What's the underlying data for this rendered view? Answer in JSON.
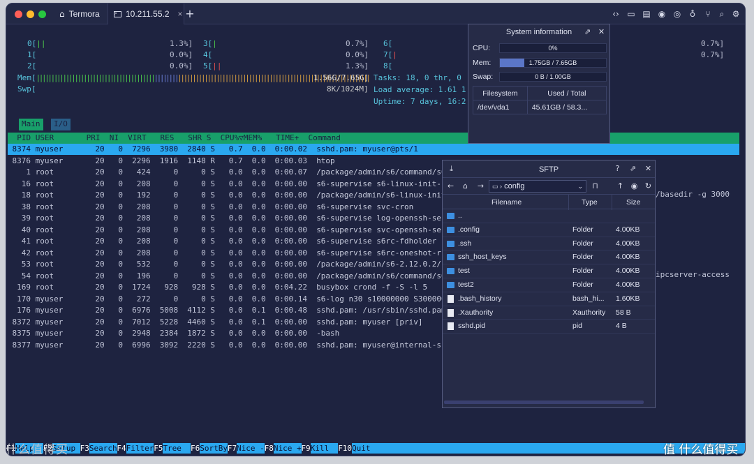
{
  "tabs": [
    {
      "label": "Termora"
    },
    {
      "label": "10.211.55.2"
    }
  ],
  "toolbar_icons": [
    "code-icon",
    "folder-icon",
    "document-icon",
    "record-icon",
    "pin-icon",
    "branch-icon",
    "search-icon",
    "gear-icon"
  ],
  "htop": {
    "cpus": [
      {
        "id": "0[",
        "meter": "||",
        "pct": "1.3%]"
      },
      {
        "id": "1[",
        "meter": "",
        "pct": "0.0%]"
      },
      {
        "id": "2[",
        "meter": "",
        "pct": "0.0%]"
      },
      {
        "id": "3[",
        "meter": "|",
        "pct": "0.7%]"
      },
      {
        "id": "4[",
        "meter": "",
        "pct": "0.0%]"
      },
      {
        "id": "5[",
        "meter": "||",
        "pct": "1.3%]"
      },
      {
        "id": "6[",
        "meter": "",
        "pct": "0.7%]"
      },
      {
        "id": "7[",
        "meter": "|",
        "pct": "0.7%]"
      },
      {
        "id": "8[",
        "meter": "",
        "pct": ""
      }
    ],
    "mem_label": "Mem[",
    "mem_meter": "||||||||||||||||||||||||||||||||||||||||||||||||||||||||||||||",
    "mem_value": "1.56G/7.65G]",
    "swp_label": "Swp[",
    "swp_value": "8K/1024M]",
    "tasks": "Tasks: 18, 0 thr, 0",
    "load": "Load average: 1.61 1",
    "uptime": "Uptime: 7 days, 16:2",
    "tab_main": "Main",
    "tab_io": "I/O",
    "columns": "  PID USER       PRI  NI  VIRT   RES   SHR S  CPU%▽MEM%   TIME+  Command",
    "processes": [
      {
        "pid": "8374",
        "user": "myuser",
        "pri": "20",
        "ni": "0",
        "virt": "7296",
        "res": "3980",
        "shr": "2840",
        "s": "S",
        "cpu": "0.7",
        "mem": "0.0",
        "time": "0:00.02",
        "cmd": "sshd.pam: myuser@pts/1"
      },
      {
        "pid": "8376",
        "user": "myuser",
        "pri": "20",
        "ni": "0",
        "virt": "2296",
        "res": "1916",
        "shr": "1148",
        "s": "R",
        "cpu": "0.7",
        "mem": "0.0",
        "time": "0:00.03",
        "cmd": "htop"
      },
      {
        "pid": "1",
        "user": "root",
        "pri": "20",
        "ni": "0",
        "virt": "424",
        "res": "0",
        "shr": "0",
        "s": "S",
        "cpu": "0.0",
        "mem": "0.0",
        "time": "0:00.07",
        "cmd": "/package/admin/s6/command/s6-"
      },
      {
        "pid": "16",
        "user": "root",
        "pri": "20",
        "ni": "0",
        "virt": "208",
        "res": "0",
        "shr": "0",
        "s": "S",
        "cpu": "0.0",
        "mem": "0.0",
        "time": "0:00.00",
        "cmd": "s6-supervise s6-linux-init-sh"
      },
      {
        "pid": "18",
        "user": "root",
        "pri": "20",
        "ni": "0",
        "virt": "192",
        "res": "0",
        "shr": "0",
        "s": "S",
        "cpu": "0.0",
        "mem": "0.0",
        "time": "0:00.00",
        "cmd": "/package/admin/s6-linux-init/"
      },
      {
        "pid": "38",
        "user": "root",
        "pri": "20",
        "ni": "0",
        "virt": "208",
        "res": "0",
        "shr": "0",
        "s": "S",
        "cpu": "0.0",
        "mem": "0.0",
        "time": "0:00.00",
        "cmd": "s6-supervise svc-cron"
      },
      {
        "pid": "39",
        "user": "root",
        "pri": "20",
        "ni": "0",
        "virt": "208",
        "res": "0",
        "shr": "0",
        "s": "S",
        "cpu": "0.0",
        "mem": "0.0",
        "time": "0:00.00",
        "cmd": "s6-supervise log-openssh-serv"
      },
      {
        "pid": "40",
        "user": "root",
        "pri": "20",
        "ni": "0",
        "virt": "208",
        "res": "0",
        "shr": "0",
        "s": "S",
        "cpu": "0.0",
        "mem": "0.0",
        "time": "0:00.00",
        "cmd": "s6-supervise svc-openssh-serv"
      },
      {
        "pid": "41",
        "user": "root",
        "pri": "20",
        "ni": "0",
        "virt": "208",
        "res": "0",
        "shr": "0",
        "s": "S",
        "cpu": "0.0",
        "mem": "0.0",
        "time": "0:00.00",
        "cmd": "s6-supervise s6rc-fdholder"
      },
      {
        "pid": "42",
        "user": "root",
        "pri": "20",
        "ni": "0",
        "virt": "208",
        "res": "0",
        "shr": "0",
        "s": "S",
        "cpu": "0.0",
        "mem": "0.0",
        "time": "0:00.00",
        "cmd": "s6-supervise s6rc-oneshot-run"
      },
      {
        "pid": "53",
        "user": "root",
        "pri": "20",
        "ni": "0",
        "virt": "532",
        "res": "0",
        "shr": "0",
        "s": "S",
        "cpu": "0.0",
        "mem": "0.0",
        "time": "0:00.00",
        "cmd": "/package/admin/s6-2.12.0.2/co"
      },
      {
        "pid": "54",
        "user": "root",
        "pri": "20",
        "ni": "0",
        "virt": "196",
        "res": "0",
        "shr": "0",
        "s": "S",
        "cpu": "0.0",
        "mem": "0.0",
        "time": "0:00.00",
        "cmd": "/package/admin/s6/command/s6-"
      },
      {
        "pid": "169",
        "user": "root",
        "pri": "20",
        "ni": "0",
        "virt": "1724",
        "res": "928",
        "shr": "928",
        "s": "S",
        "cpu": "0.0",
        "mem": "0.0",
        "time": "0:04.22",
        "cmd": "busybox crond -f -S -l 5"
      },
      {
        "pid": "170",
        "user": "myuser",
        "pri": "20",
        "ni": "0",
        "virt": "272",
        "res": "0",
        "shr": "0",
        "s": "S",
        "cpu": "0.0",
        "mem": "0.0",
        "time": "0:00.14",
        "cmd": "s6-log n30 s10000000 S3000000"
      },
      {
        "pid": "176",
        "user": "myuser",
        "pri": "20",
        "ni": "0",
        "virt": "6976",
        "res": "5008",
        "shr": "4112",
        "s": "S",
        "cpu": "0.0",
        "mem": "0.1",
        "time": "0:00.48",
        "cmd": "sshd.pam: /usr/sbin/sshd.pam"
      },
      {
        "pid": "8372",
        "user": "myuser",
        "pri": "20",
        "ni": "0",
        "virt": "7012",
        "res": "5228",
        "shr": "4460",
        "s": "S",
        "cpu": "0.0",
        "mem": "0.1",
        "time": "0:00.00",
        "cmd": "sshd.pam: myuser [priv]"
      },
      {
        "pid": "8375",
        "user": "myuser",
        "pri": "20",
        "ni": "0",
        "virt": "2948",
        "res": "2384",
        "shr": "1872",
        "s": "S",
        "cpu": "0.0",
        "mem": "0.0",
        "time": "0:00.00",
        "cmd": "-bash"
      },
      {
        "pid": "8377",
        "user": "myuser",
        "pri": "20",
        "ni": "0",
        "virt": "6996",
        "res": "3092",
        "shr": "2220",
        "s": "S",
        "cpu": "0.0",
        "mem": "0.0",
        "time": "0:00.00",
        "cmd": "sshd.pam: myuser@internal-sft"
      }
    ],
    "overflow_text_1": "/basedir -g 3000",
    "overflow_text_2": "ipcserver-access",
    "function_keys": [
      {
        "key": "F1",
        "label": "Help  "
      },
      {
        "key": "F2",
        "label": "Setup "
      },
      {
        "key": "F3",
        "label": "Search"
      },
      {
        "key": "F4",
        "label": "Filter"
      },
      {
        "key": "F5",
        "label": "Tree  "
      },
      {
        "key": "F6",
        "label": "SortBy"
      },
      {
        "key": "F7",
        "label": "Nice -"
      },
      {
        "key": "F8",
        "label": "Nice +"
      },
      {
        "key": "F9",
        "label": "Kill  "
      },
      {
        "key": "F10",
        "label": "Quit  "
      }
    ]
  },
  "sysinfo": {
    "title": "System information",
    "cpu_label": "CPU:",
    "cpu_value": "0%",
    "cpu_fraction": 0.0,
    "mem_label": "Mem:",
    "mem_value": "1.75GB / 7.65GB",
    "mem_fraction": 0.229,
    "swap_label": "Swap:",
    "swap_value": "0 B / 1.00GB",
    "swap_fraction": 0.0,
    "fs_header": "Filesystem",
    "used_header": "Used / Total",
    "fs_name": "/dev/vda1",
    "fs_used": "45.61GB / 58.3..."
  },
  "sftp": {
    "title": "SFTP",
    "path": "config",
    "col_filename": "Filename",
    "col_type": "Type",
    "col_size": "Size",
    "files": [
      {
        "name": "..",
        "type": "",
        "size": "",
        "kind": "folder"
      },
      {
        "name": ".config",
        "type": "Folder",
        "size": "4.00KB",
        "kind": "folder"
      },
      {
        "name": ".ssh",
        "type": "Folder",
        "size": "4.00KB",
        "kind": "folder"
      },
      {
        "name": "ssh_host_keys",
        "type": "Folder",
        "size": "4.00KB",
        "kind": "folder"
      },
      {
        "name": "test",
        "type": "Folder",
        "size": "4.00KB",
        "kind": "folder"
      },
      {
        "name": "test2",
        "type": "Folder",
        "size": "4.00KB",
        "kind": "folder"
      },
      {
        "name": ".bash_history",
        "type": "bash_hi...",
        "size": "1.60KB",
        "kind": "file"
      },
      {
        "name": ".Xauthority",
        "type": "Xauthority",
        "size": "58 B",
        "kind": "file"
      },
      {
        "name": "sshd.pid",
        "type": "pid",
        "size": "4 B",
        "kind": "file"
      }
    ]
  },
  "watermark_left": "什么值得买",
  "watermark_right": "值 什么值得买",
  "colors": {
    "accent": "#2aa8f0",
    "header_green": "#18a06a",
    "window_bg": "#1e2340"
  }
}
